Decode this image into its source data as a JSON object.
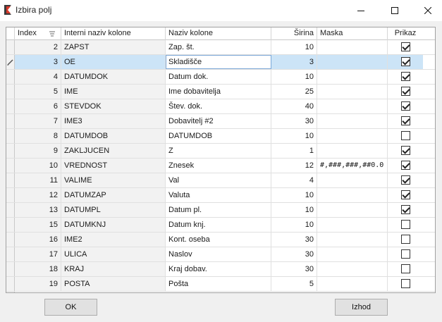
{
  "window": {
    "title": "Izbira polj"
  },
  "columns": {
    "index": "Index",
    "internal": "Interni naziv kolone",
    "name": "Naziv kolone",
    "width": "Širina",
    "mask": "Maska",
    "show": "Prikaz"
  },
  "rows": [
    {
      "index": "2",
      "internal": "ZAPST",
      "name": "Zap. št.",
      "width": "10",
      "mask": "",
      "show": true
    },
    {
      "index": "3",
      "internal": "OE",
      "name": "Skladišče",
      "width": "3",
      "mask": "",
      "show": true
    },
    {
      "index": "4",
      "internal": "DATUMDOK",
      "name": "Datum dok.",
      "width": "10",
      "mask": "",
      "show": true
    },
    {
      "index": "5",
      "internal": "IME",
      "name": "Ime dobavitelja",
      "width": "25",
      "mask": "",
      "show": true
    },
    {
      "index": "6",
      "internal": "STEVDOK",
      "name": "Štev. dok.",
      "width": "40",
      "mask": "",
      "show": true
    },
    {
      "index": "7",
      "internal": "IME3",
      "name": "Dobavitelj #2",
      "width": "30",
      "mask": "",
      "show": true
    },
    {
      "index": "8",
      "internal": "DATUMDOB",
      "name": "DATUMDOB",
      "width": "10",
      "mask": "",
      "show": false
    },
    {
      "index": "9",
      "internal": "ZAKLJUCEN",
      "name": "Z",
      "width": "1",
      "mask": "",
      "show": true
    },
    {
      "index": "10",
      "internal": "VREDNOST",
      "name": "Znesek",
      "width": "12",
      "mask": "#,###,###,##0.0",
      "show": true
    },
    {
      "index": "11",
      "internal": "VALIME",
      "name": "Val",
      "width": "4",
      "mask": "",
      "show": true
    },
    {
      "index": "12",
      "internal": "DATUMZAP",
      "name": "Valuta",
      "width": "10",
      "mask": "",
      "show": true
    },
    {
      "index": "13",
      "internal": "DATUMPL",
      "name": "Datum pl.",
      "width": "10",
      "mask": "",
      "show": true
    },
    {
      "index": "15",
      "internal": "DATUMKNJ",
      "name": "Datum knj.",
      "width": "10",
      "mask": "",
      "show": false
    },
    {
      "index": "16",
      "internal": "IME2",
      "name": "Kont. oseba",
      "width": "30",
      "mask": "",
      "show": false
    },
    {
      "index": "17",
      "internal": "ULICA",
      "name": "Naslov",
      "width": "30",
      "mask": "",
      "show": false
    },
    {
      "index": "18",
      "internal": "KRAJ",
      "name": "Kraj dobav.",
      "width": "30",
      "mask": "",
      "show": false
    },
    {
      "index": "19",
      "internal": "POSTA",
      "name": "Pošta",
      "width": "5",
      "mask": "",
      "show": false
    }
  ],
  "buttons": {
    "ok": "OK",
    "izhod": "Izhod"
  }
}
